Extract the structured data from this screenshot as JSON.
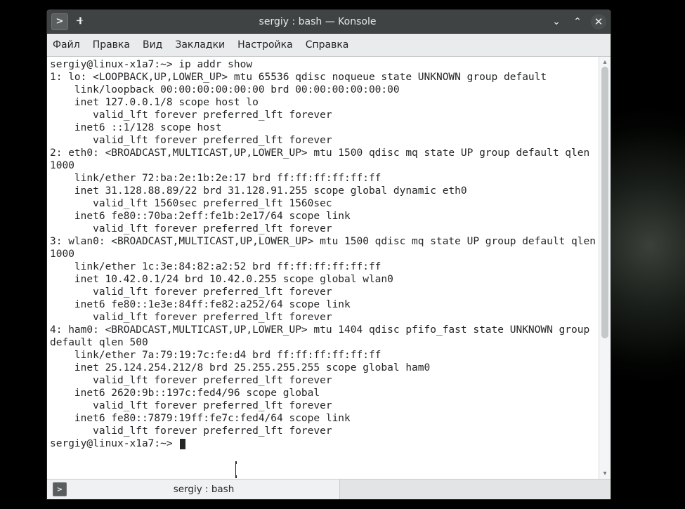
{
  "window": {
    "title": "sergiy : bash — Konsole",
    "controls": {
      "newtab_symbol": ">",
      "pin_symbol": "📌",
      "minimize_symbol": "⌄",
      "maximize_symbol": "⌃",
      "close_symbol": "✕"
    }
  },
  "menu": {
    "items": [
      "Файл",
      "Правка",
      "Вид",
      "Закладки",
      "Настройка",
      "Справка"
    ]
  },
  "terminal": {
    "prompt1": "sergiy@linux-x1a7:~> ",
    "command1": "ip addr show",
    "output": "1: lo: <LOOPBACK,UP,LOWER_UP> mtu 65536 qdisc noqueue state UNKNOWN group default\n    link/loopback 00:00:00:00:00:00 brd 00:00:00:00:00:00\n    inet 127.0.0.1/8 scope host lo\n       valid_lft forever preferred_lft forever\n    inet6 ::1/128 scope host\n       valid_lft forever preferred_lft forever\n2: eth0: <BROADCAST,MULTICAST,UP,LOWER_UP> mtu 1500 qdisc mq state UP group default qlen 1000\n    link/ether 72:ba:2e:1b:2e:17 brd ff:ff:ff:ff:ff:ff\n    inet 31.128.88.89/22 brd 31.128.91.255 scope global dynamic eth0\n       valid_lft 1560sec preferred_lft 1560sec\n    inet6 fe80::70ba:2eff:fe1b:2e17/64 scope link\n       valid_lft forever preferred_lft forever\n3: wlan0: <BROADCAST,MULTICAST,UP,LOWER_UP> mtu 1500 qdisc mq state UP group default qlen 1000\n    link/ether 1c:3e:84:82:a2:52 brd ff:ff:ff:ff:ff:ff\n    inet 10.42.0.1/24 brd 10.42.0.255 scope global wlan0\n       valid_lft forever preferred_lft forever\n    inet6 fe80::1e3e:84ff:fe82:a252/64 scope link\n       valid_lft forever preferred_lft forever\n4: ham0: <BROADCAST,MULTICAST,UP,LOWER_UP> mtu 1404 qdisc pfifo_fast state UNKNOWN group default qlen 500\n    link/ether 7a:79:19:7c:fe:d4 brd ff:ff:ff:ff:ff:ff\n    inet 25.124.254.212/8 brd 25.255.255.255 scope global ham0\n       valid_lft forever preferred_lft forever\n    inet6 2620:9b::197c:fed4/96 scope global\n       valid_lft forever preferred_lft forever\n    inet6 fe80::7879:19ff:fe7c:fed4/64 scope link\n       valid_lft forever preferred_lft forever",
    "prompt2": "sergiy@linux-x1a7:~> "
  },
  "tabs": [
    {
      "icon": ">",
      "label": "sergiy : bash"
    }
  ],
  "colors": {
    "titlebar_bg": "#3f4344",
    "terminal_bg": "#ffffff",
    "terminal_fg": "#232627",
    "menubar_bg": "#e9ebec"
  }
}
